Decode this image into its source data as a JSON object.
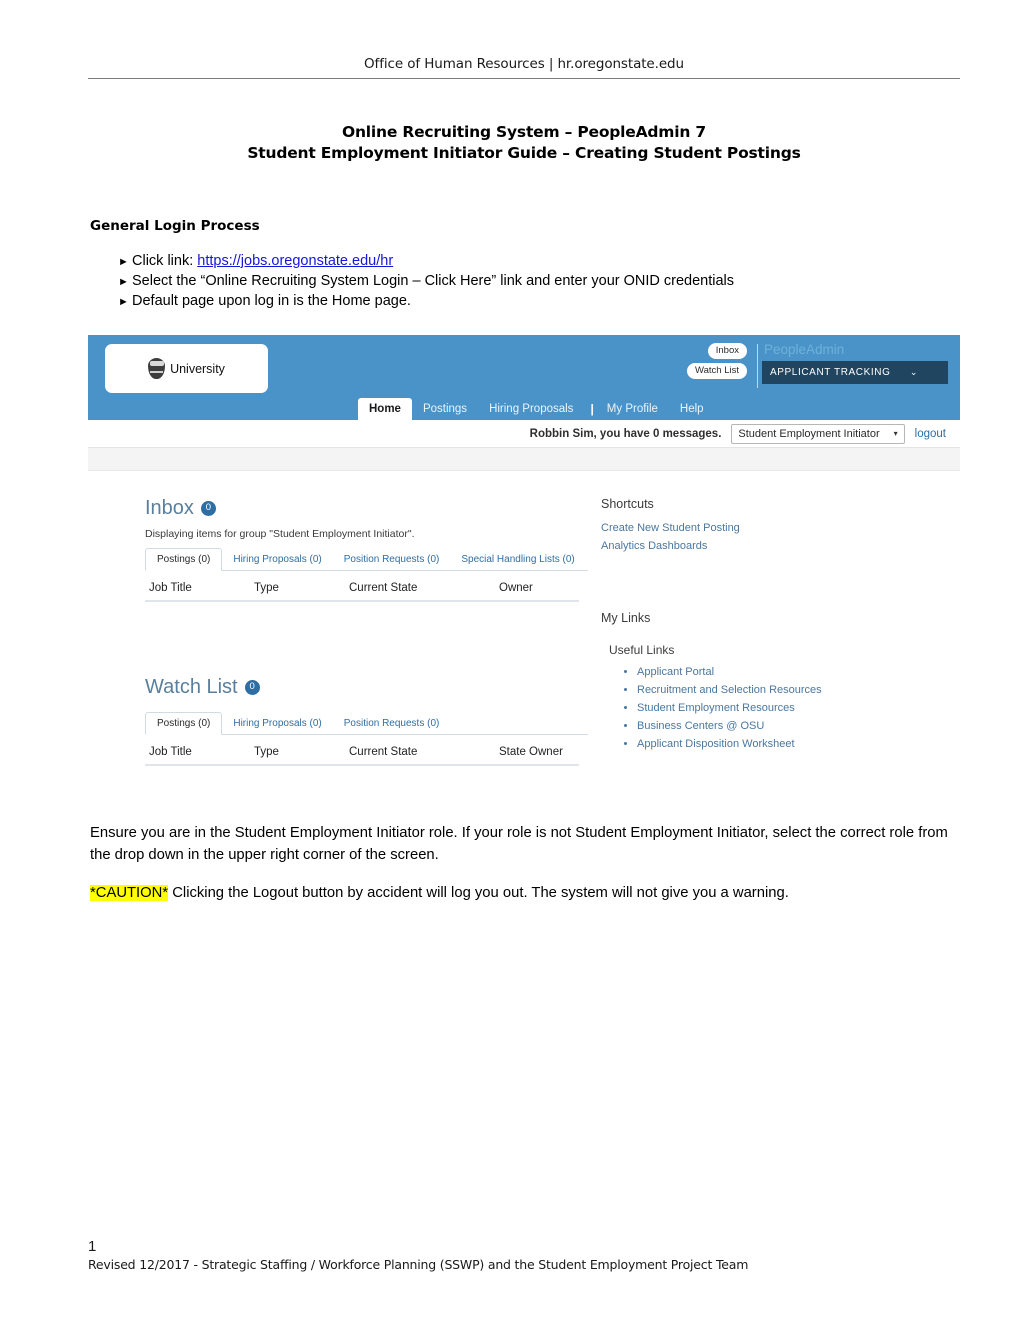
{
  "page_header": {
    "text": "Office of Human Resources | hr.oregonstate.edu"
  },
  "title": {
    "line1": "Online Recruiting System – PeopleAdmin 7",
    "line2": "Student Employment Initiator Guide – Creating Student Postings"
  },
  "section": {
    "heading": "General Login Process"
  },
  "bullets": [
    {
      "arrow": "►",
      "text": "Click link: ",
      "link": "https://jobs.oregonstate.edu/hr",
      "tail": ""
    },
    {
      "arrow": "►",
      "text": "Select the “Online Recruiting System Login – Click Here” link and enter your ONID credentials"
    },
    {
      "arrow": "►",
      "text": "Default page upon log in is the Home page."
    }
  ],
  "screenshot": {
    "masthead": {
      "logo_word": "University",
      "pills": [
        "Inbox",
        "Watch List"
      ],
      "brand": "PeopleAdmin",
      "module": "APPLICANT TRACKING",
      "module_caret": "⌄"
    },
    "nav": {
      "tabs": [
        "Home",
        "Postings",
        "Hiring Proposals",
        "My Profile",
        "Help"
      ],
      "separator": "|",
      "active": "Home"
    },
    "userbar": {
      "message": "Robbin Sim, you have 0 messages.",
      "role": "Student Employment Initiator",
      "role_caret": "▾",
      "logout": "logout"
    },
    "inbox": {
      "title": "Inbox",
      "count": "0",
      "subtitle": "Displaying items for group \"Student Employment Initiator\".",
      "tabs": [
        "Postings (0)",
        "Hiring Proposals (0)",
        "Position Requests (0)",
        "Special Handling Lists (0)"
      ],
      "columns": [
        "Job Title",
        "Type",
        "Current State",
        "Owner"
      ]
    },
    "watchlist": {
      "title": "Watch List",
      "count": "0",
      "tabs": [
        "Postings (0)",
        "Hiring Proposals (0)",
        "Position Requests (0)"
      ],
      "columns": [
        "Job Title",
        "Type",
        "Current State",
        "State Owner"
      ]
    },
    "shortcuts": {
      "heading": "Shortcuts",
      "links": [
        "Create New Student Posting",
        "Analytics Dashboards"
      ]
    },
    "mylinks": {
      "heading": "My Links",
      "group_heading": "Useful Links",
      "links": [
        "Applicant Portal",
        "Recruitment and Selection Resources",
        "Student Employment Resources",
        "Business Centers @ OSU",
        "Applicant Disposition Worksheet"
      ]
    }
  },
  "paragraphs": {
    "role_note": "Ensure you are in the Student Employment Initiator role. If your role is not Student Employment Initiator, select the correct role from the drop down in the upper right corner of the screen.",
    "caution_label": "*CAUTION*",
    "caution_text": " Clicking the Logout button by accident will log you out. The system will not give you a warning."
  },
  "footer": {
    "page_number": "1",
    "note": "Revised 12/2017 - Strategic Staffing / Workforce Planning (SSWP) and the Student Employment Project Team"
  },
  "colors": {
    "masthead_blue": "#4a93c8",
    "module_navy": "#1f4560",
    "link_blue": "#2f6ea3",
    "doc_link": "#1616d6",
    "highlight": "#ffff00"
  }
}
